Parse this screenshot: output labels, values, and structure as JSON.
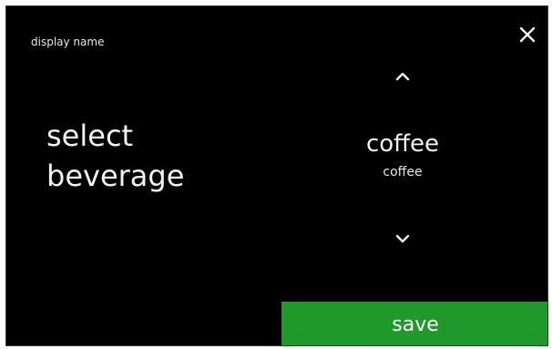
{
  "header": {
    "title": "display name",
    "close_icon": "close-icon"
  },
  "main": {
    "prompt_line1": "select",
    "prompt_line2": "beverage"
  },
  "picker": {
    "up_icon": "chevron-up-icon",
    "down_icon": "chevron-down-icon",
    "value": "coffee",
    "sub_value": "coffee"
  },
  "actions": {
    "save_label": "save"
  },
  "colors": {
    "background": "#000000",
    "accent": "#1f9a2a",
    "text": "#f2f2f2"
  }
}
